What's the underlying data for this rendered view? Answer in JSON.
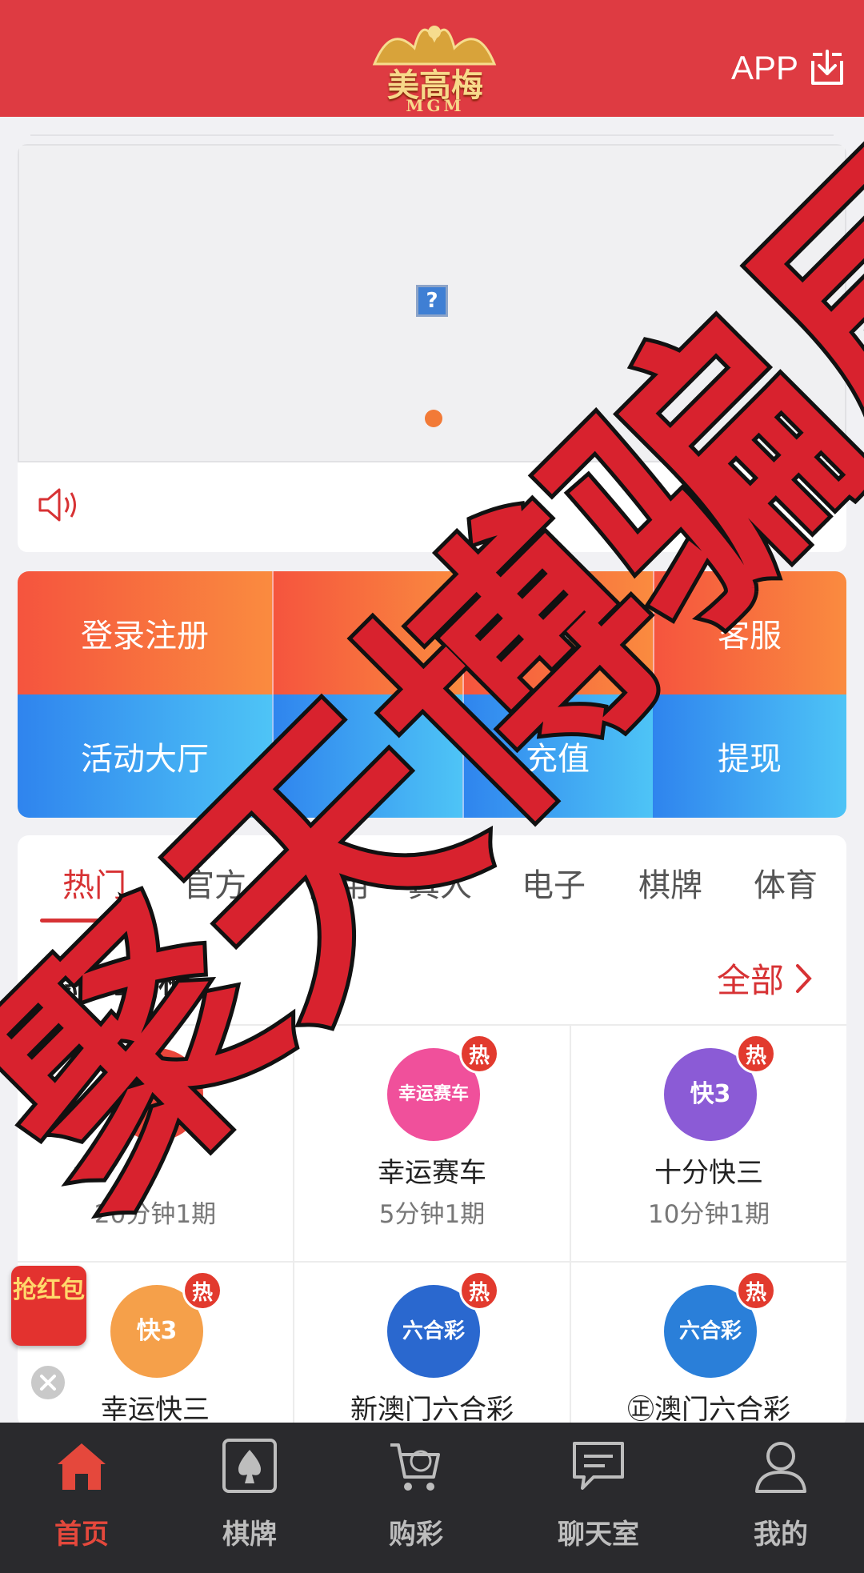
{
  "header": {
    "logo_cn": "美高梅",
    "logo_en": "MGM",
    "app_label": "APP"
  },
  "banner": {
    "broken_image_glyph": "?"
  },
  "quick_actions": {
    "row1": [
      "登录注册",
      "",
      "红包",
      "客服"
    ],
    "row2": [
      "活动大厅",
      "",
      "充值",
      "提现"
    ]
  },
  "tabs": {
    "items": [
      "热门",
      "官方",
      "信用",
      "真人",
      "电子",
      "棋牌",
      "体育"
    ],
    "active": "热门"
  },
  "section": {
    "title": "热门彩种",
    "see_all": "全部"
  },
  "games": [
    {
      "name": "",
      "freq": "20分钟1期",
      "icon": "lottery-ball-icon",
      "hot": "",
      "color": "#e9463b"
    },
    {
      "name": "幸运赛车",
      "freq": "5分钟1期",
      "icon": "lucky-racing-icon",
      "icon_text": "幸运赛车",
      "hot": "热",
      "color": "#f0509b"
    },
    {
      "name": "十分快三",
      "freq": "10分钟1期",
      "icon": "ten-minute-k3-icon",
      "icon_text": "快3",
      "hot": "热",
      "color": "#8b5bd6"
    },
    {
      "name": "幸运快三",
      "freq": "",
      "icon": "lucky-k3-icon",
      "icon_text": "快3",
      "hot": "热",
      "color": "#f5a04a"
    },
    {
      "name": "新澳门六合彩",
      "freq": "",
      "icon": "new-macau-mark-six-icon",
      "icon_text": "六合彩",
      "hot": "热",
      "color": "#2a68cf"
    },
    {
      "name": "㊣澳门六合彩",
      "freq": "",
      "icon": "macau-mark-six-icon",
      "icon_text": "六合彩",
      "hot": "热",
      "color": "#2a7fd9"
    }
  ],
  "red_packet": {
    "label": "抢红包"
  },
  "watermark": {
    "text": "聚天博骗局赚累"
  },
  "bottom_nav": [
    {
      "label": "首页",
      "icon": "home-icon",
      "active": true
    },
    {
      "label": "棋牌",
      "icon": "spade-card-icon",
      "active": false
    },
    {
      "label": "购彩",
      "icon": "cart-icon",
      "active": false
    },
    {
      "label": "聊天室",
      "icon": "chat-icon",
      "active": false
    },
    {
      "label": "我的",
      "icon": "user-icon",
      "active": false
    }
  ],
  "colors": {
    "brand_red": "#de3b42",
    "accent_red": "#d73234",
    "nav_bg": "#2a2a2d"
  }
}
